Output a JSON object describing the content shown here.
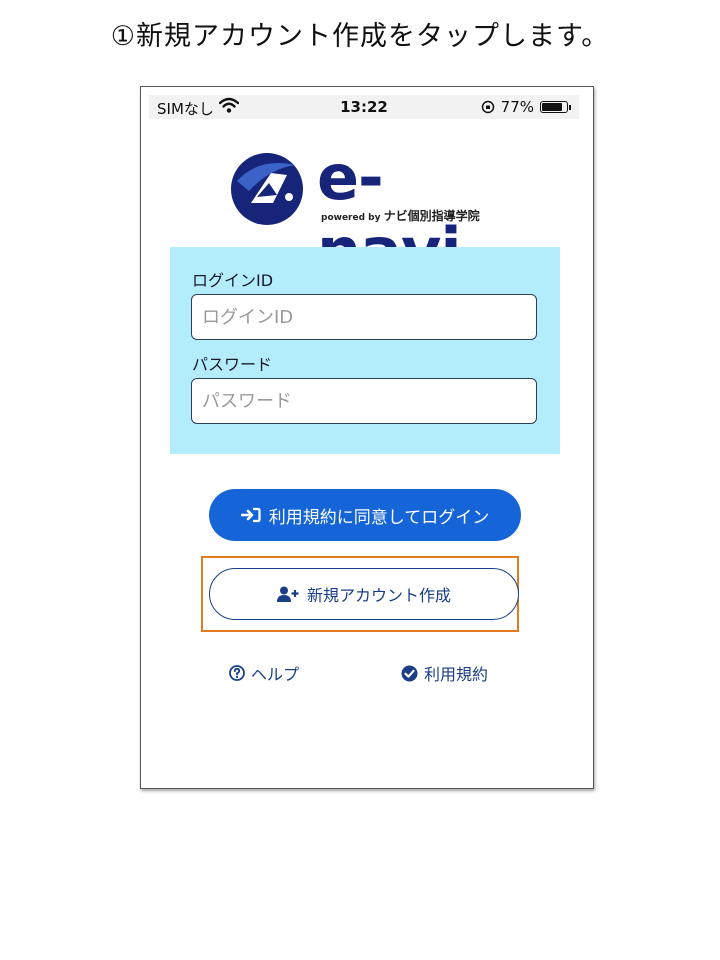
{
  "instruction": "①新規アカウント作成をタップします。",
  "status_bar": {
    "carrier": "SIMなし",
    "time": "13:22",
    "battery": "77%",
    "battery_level": 0.77
  },
  "logo": {
    "name": "e-navi",
    "powered_by": "powered by",
    "company": "ナビ個別指導学院"
  },
  "form": {
    "login_id_label": "ログインID",
    "login_id_placeholder": "ログインID",
    "password_label": "パスワード",
    "password_placeholder": "パスワード"
  },
  "buttons": {
    "login": "利用規約に同意してログイン",
    "create_account": "新規アカウント作成"
  },
  "links": {
    "help": "ヘルプ",
    "terms": "利用規約"
  },
  "colors": {
    "accent": "#1565d8",
    "panel": "#b3ecfb",
    "highlight": "#e07b22",
    "brand": "#16257a"
  },
  "icons": {
    "wifi": "wifi-icon",
    "login": "sign-in-icon",
    "create": "user-plus-icon",
    "help": "question-circle-icon",
    "terms": "check-circle-icon"
  }
}
